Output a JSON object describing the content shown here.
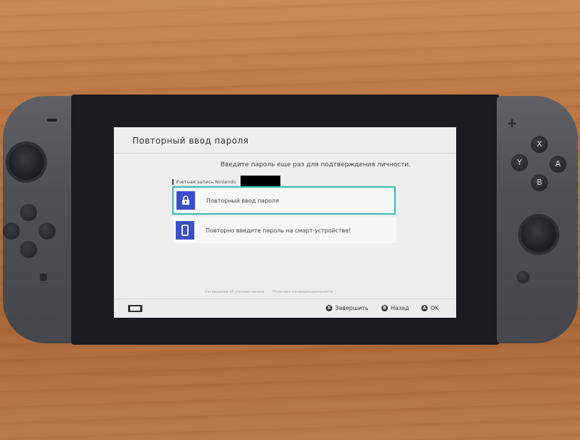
{
  "screen": {
    "title": "Повторный ввод пароля",
    "prompt": "Введите пароль еще раз для подтверждения личности.",
    "account_label": "Учетная запись Nintendo",
    "options": [
      {
        "label": "Повторный ввод пароля",
        "icon": "lock-icon",
        "selected": true
      },
      {
        "label": "Повторно введите пароль на смарт-устройстве!",
        "icon": "smart-device-icon",
        "selected": false
      }
    ],
    "links": [
      "Соглашение об учетной записи",
      "Политика конфиденциальности"
    ],
    "footer": {
      "buttons": [
        {
          "key": "X",
          "label": "Завершить"
        },
        {
          "key": "B",
          "label": "Назад"
        },
        {
          "key": "A",
          "label": "OK"
        }
      ]
    }
  },
  "controller": {
    "right_buttons": [
      "X",
      "Y",
      "A",
      "B"
    ]
  },
  "colors": {
    "accent": "#3c4fc8",
    "selection_border": "#39b8b0",
    "screen_bg": "#eeeeee"
  }
}
